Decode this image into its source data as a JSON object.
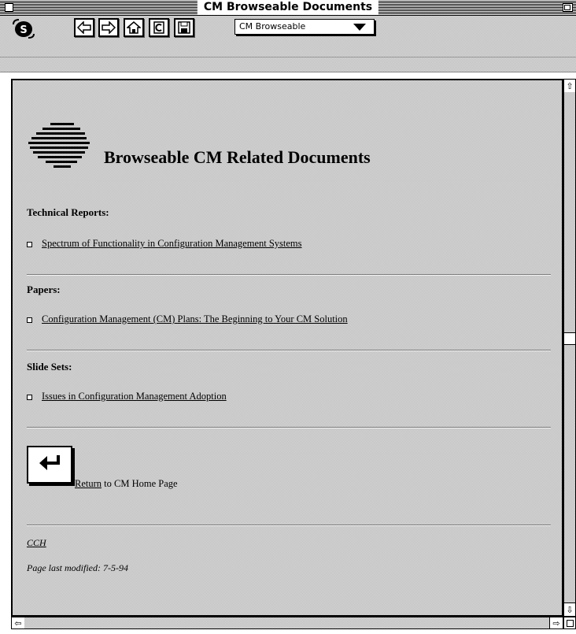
{
  "window": {
    "title": "CM Browseable Documents"
  },
  "toolbar": {
    "buttons": [
      {
        "name": "back",
        "icon": "arrow-left-icon"
      },
      {
        "name": "forward",
        "icon": "arrow-right-icon"
      },
      {
        "name": "home",
        "icon": "home-icon"
      },
      {
        "name": "reload",
        "icon": "reload-icon"
      },
      {
        "name": "save",
        "icon": "save-icon"
      }
    ],
    "document_select": {
      "selected": "CM Browseable"
    }
  },
  "page": {
    "heading": "Browseable CM Related Documents",
    "sections": [
      {
        "title": "Technical Reports:",
        "items": [
          "Spectrum of Functionality in Configuration Management Systems"
        ]
      },
      {
        "title": "Papers:",
        "items": [
          "Configuration Management (CM) Plans: The Beginning to Your CM Solution"
        ]
      },
      {
        "title": "Slide Sets:",
        "items": [
          "Issues in Configuration Management Adoption"
        ]
      }
    ],
    "return_link": "Return",
    "return_text": " to CM Home Page",
    "author_link": "CCH",
    "last_modified": "Page last modified: 7-5-94"
  },
  "colors": {
    "background": "#d6d6d6",
    "text": "#000000",
    "frame": "#000000"
  }
}
